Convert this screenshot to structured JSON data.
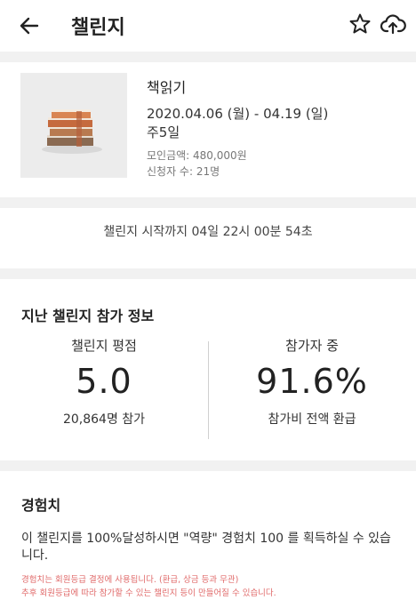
{
  "header": {
    "title": "챌린지",
    "back_icon": "arrow-left-icon",
    "star_icon": "star-outline-icon",
    "upload_icon": "cloud-upload-icon"
  },
  "challenge": {
    "name": "책읽기",
    "dates": "2020.04.06 (월) - 04.19 (일)",
    "frequency": "주5일",
    "raised": "모인금액: 480,000원",
    "applicants": "신청자 수: 21명"
  },
  "countdown": "챌린지 시작까지 04일 22시 00분 54초",
  "past_info": {
    "title": "지난 챌린지 참가 정보",
    "rating_label": "챌린지 평점",
    "rating_value": "5.0",
    "participants": "20,864명 참가",
    "participants_label": "참가자 중",
    "refund_rate": "91.6%",
    "refund_label": "참가비 전액 환급"
  },
  "experience": {
    "title": "경험치",
    "description": "이 챌린지를 100%달성하시면 \"역량\" 경험치 100 를 획득하실 수 있습니다.",
    "note_1": "경험치는 회원등급 결정에 사용됩니다. (환급, 상금 등과 무관)",
    "note_2": "추후 회원등급에 따라 참가할 수 있는 챌린지 등이 만들어질 수 있습니다."
  },
  "colors": {
    "separator": "#f1f1f1",
    "note_red": "#e06a6a"
  }
}
